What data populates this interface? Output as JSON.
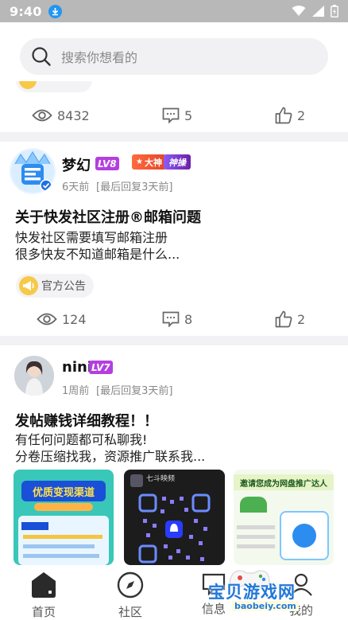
{
  "status_bar": {
    "time": "9:40"
  },
  "search": {
    "placeholder": "搜索你想看的"
  },
  "post0": {
    "views": "8432",
    "comments": "5",
    "likes": "2"
  },
  "post1": {
    "username": "梦幻",
    "level": "LV8",
    "badge_dashen": "大神",
    "badge_shen": "神操",
    "time": "6天前",
    "last_reply": "[最后回复3天前]",
    "title": "关于快发社区注册®邮箱问题",
    "body_lines": [
      "快发社区需要填写邮箱注册",
      "很多快友不知道邮箱是什么..."
    ],
    "tag": "官方公告",
    "views": "124",
    "comments": "8",
    "likes": "2"
  },
  "post2": {
    "username": "nini",
    "level": "LV7",
    "time": "1周前",
    "last_reply": "[最后回复3天前]",
    "title": "发帖赚钱详细教程！！",
    "body_lines": [
      "有任何问题都可私聊我!",
      "分卷压缩找我，资源推广联系我..."
    ],
    "thumbs": [
      {
        "headline": "优质变现渠道"
      },
      {
        "headline": "七斗映频"
      },
      {
        "headline": "邀请您成为网盘推广达人"
      }
    ]
  },
  "nav": {
    "items": [
      {
        "label": "首页"
      },
      {
        "label": "社区"
      },
      {
        "label": "信息"
      },
      {
        "label": "我的"
      }
    ]
  },
  "watermark": {
    "line1": "宝贝游戏网",
    "line2": "baobeiy.com"
  },
  "colors": {
    "level_purple": "#b43ee0",
    "divider": "#f2f2f4",
    "accent_blue": "#2196f3"
  }
}
